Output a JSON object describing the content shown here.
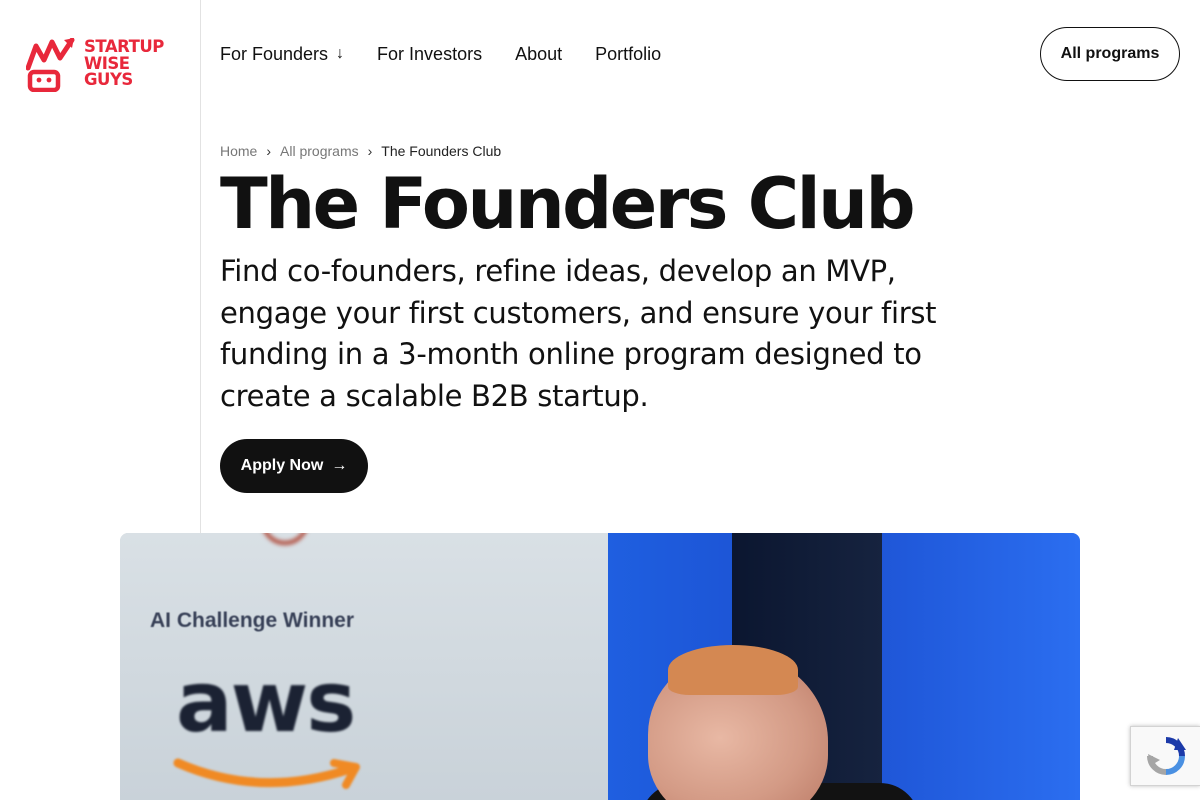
{
  "brand": {
    "name_lines": [
      "STARTUP",
      "WISE",
      "GUYS"
    ],
    "color": "#e8283b"
  },
  "nav": {
    "items": [
      {
        "label": "For Founders",
        "has_dropdown": true
      },
      {
        "label": "For Investors"
      },
      {
        "label": "About"
      },
      {
        "label": "Portfolio"
      }
    ],
    "cta_label": "All programs"
  },
  "breadcrumb": {
    "home": "Home",
    "parent": "All programs",
    "current": "The Founders Club",
    "separator": "›"
  },
  "hero": {
    "title": "The Founders Club",
    "lead": "Find co-founders, refine ideas, develop an MVP, engage your first customers, and ensure your first funding in a 3-month online program designed to create a scalable B2B startup.",
    "apply_label": "Apply Now"
  },
  "photo": {
    "caption": "AI Challenge Winner",
    "sponsor_logo_text": "aws"
  },
  "icons": {
    "dropdown": "arrow-down-icon",
    "apply": "arrow-right-icon",
    "recaptcha": "recaptcha-icon"
  }
}
